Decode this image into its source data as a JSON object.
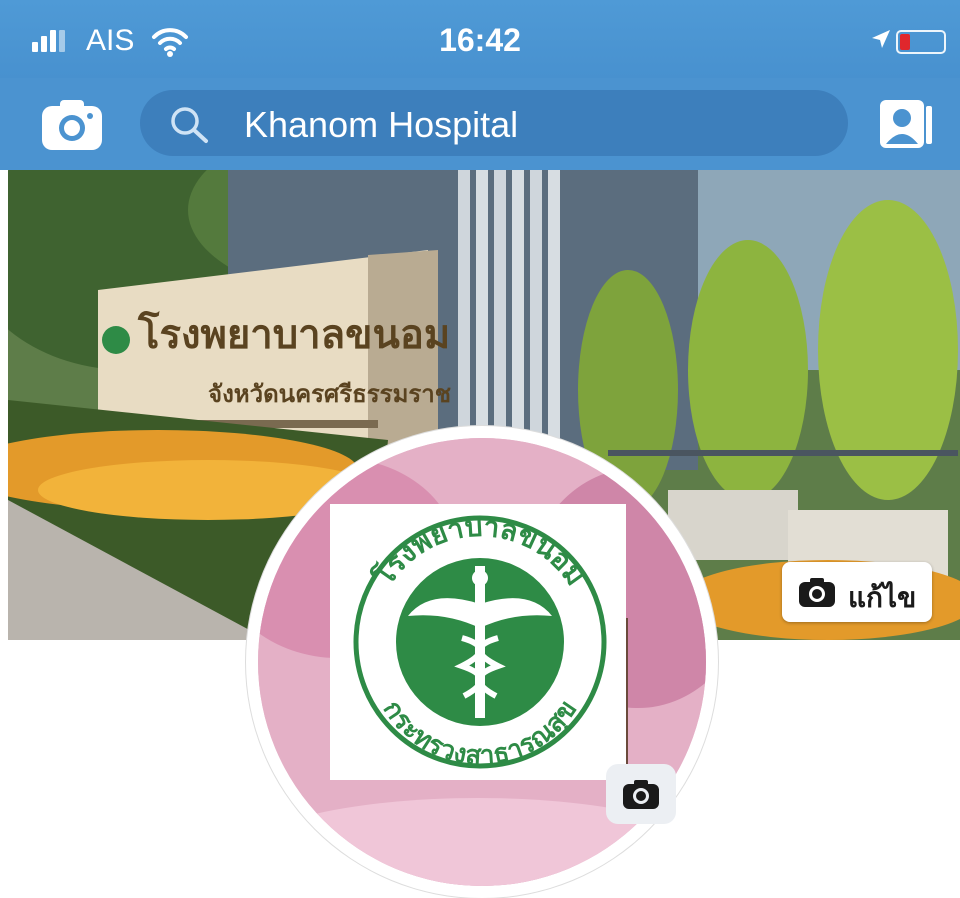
{
  "status_bar": {
    "carrier": "AIS",
    "time": "16:42"
  },
  "nav": {
    "search_text": "Khanom Hospital",
    "camera_icon": "camera-icon",
    "contacts_icon": "contacts-icon"
  },
  "cover": {
    "sign_title": "โรงพยาบาลขนอม",
    "sign_subtitle": "จังหวัดนครศรีธรรมราช",
    "edit_label": "แก้ไข"
  },
  "profile": {
    "logo_top_text": "โรงพยาบาลขนอม",
    "logo_bottom_text": "กระทรวงสาธารณสุข"
  },
  "colors": {
    "header_blue": "#4b93d0",
    "search_blue": "#3d7fbc",
    "logo_green": "#2e8b46"
  }
}
